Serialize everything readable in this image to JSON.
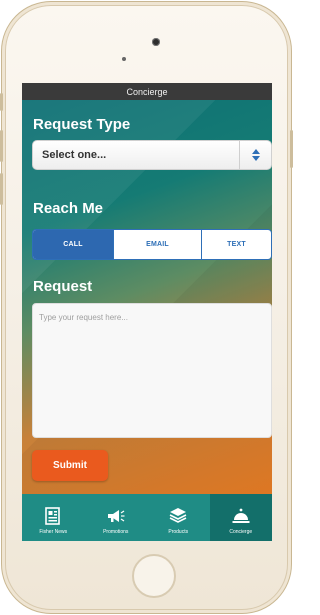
{
  "app": {
    "title": "Concierge"
  },
  "form": {
    "request_type_label": "Request Type",
    "request_type_select": {
      "selected": "Select one..."
    },
    "reach_me_label": "Reach Me",
    "reach_me_options": [
      {
        "label": "CALL",
        "selected": true
      },
      {
        "label": "EMAIL",
        "selected": false
      },
      {
        "label": "TEXT",
        "selected": false
      }
    ],
    "request_label": "Request",
    "request_placeholder": "Type your request here...",
    "request_value": "",
    "submit_label": "Submit"
  },
  "tab_bar": {
    "tabs": [
      {
        "label": "Fisher News",
        "icon": "newspaper-icon",
        "active": false
      },
      {
        "label": "Promotions",
        "icon": "megaphone-icon",
        "active": false
      },
      {
        "label": "Products",
        "icon": "stack-layers-icon",
        "active": false
      },
      {
        "label": "Concierge",
        "icon": "service-bell-icon",
        "active": true
      }
    ]
  },
  "colors": {
    "status_bar": "#3a3a3a",
    "gradient_teal": "#0d6f74",
    "gradient_orange": "#ea7d25",
    "segment_active": "#2d68b0",
    "submit_button": "#ea5a1e",
    "tab_bar": "#1f8c85",
    "tab_active": "#136f6a"
  }
}
